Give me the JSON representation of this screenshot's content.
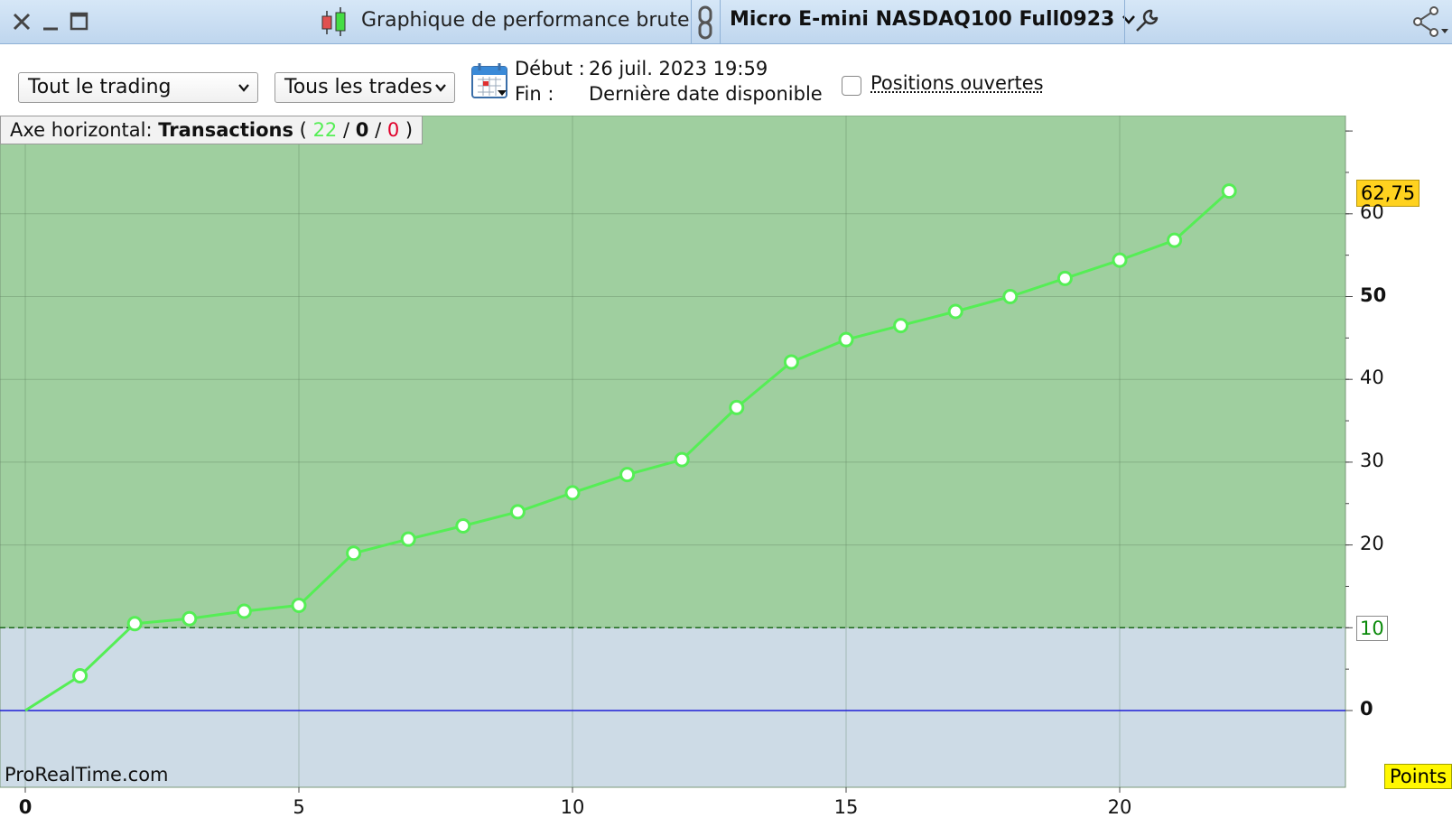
{
  "window": {
    "title": "Graphique de performance brute",
    "instrument": "Micro E-mini NASDAQ100 Full0923",
    "icons": [
      "close-icon",
      "minimize-icon",
      "maximize-icon",
      "candlestick-icon",
      "link-icon",
      "chevron-down-icon",
      "wrench-icon",
      "share-icon"
    ]
  },
  "toolbar": {
    "scope_select": "Tout le trading",
    "trades_select": "Tous les trades",
    "start_label": "Début :",
    "start_value": "26 juil. 2023 19:59",
    "end_label": "Fin :",
    "end_value": "Dernière date disponible",
    "open_positions_label": "Positions ouvertes",
    "open_positions_checked": false
  },
  "axis_badge": {
    "prefix": "Axe horizontal:",
    "mode": "Transactions",
    "open_paren": "(",
    "wins": "22",
    "sep1": "/",
    "neutral": "0",
    "sep2": "/",
    "losses": "0",
    "close_paren": ")"
  },
  "watermark": "ProRealTime.com",
  "unit_badge": "Points",
  "last_value_label": "62,75",
  "threshold_label": "10",
  "colors": {
    "positive_zone": "#9fcf9f",
    "negative_zone": "#cddbe6",
    "curve": "#55ee55",
    "zero_line": "#1f1fd6",
    "threshold_line": "#1f6a1f",
    "last_value_badge": "#ffd21f",
    "wins": "#55ee55",
    "losses": "#e0002a"
  },
  "chart_data": {
    "type": "line",
    "x": [
      0,
      1,
      2,
      3,
      4,
      5,
      6,
      7,
      8,
      9,
      10,
      11,
      12,
      13,
      14,
      15,
      16,
      17,
      18,
      19,
      20,
      21,
      22
    ],
    "series": [
      {
        "values": [
          0,
          4.2,
          10.5,
          11.1,
          12.0,
          12.7,
          19.0,
          20.7,
          22.3,
          24.0,
          26.3,
          28.5,
          30.3,
          36.6,
          42.1,
          44.8,
          46.5,
          48.2,
          50.0,
          52.2,
          54.4,
          56.8,
          62.75
        ]
      }
    ],
    "xlim": [
      0,
      24
    ],
    "ylim": [
      -9.3,
      70.5
    ],
    "xticks": [
      0,
      5,
      10,
      15,
      20
    ],
    "xtick_labels": [
      "0",
      "5",
      "10",
      "15",
      "20"
    ],
    "yticks": [
      0,
      10,
      20,
      30,
      40,
      50,
      60
    ],
    "ytick_labels": [
      "0",
      "",
      "20",
      "30",
      "40",
      "50",
      "60"
    ],
    "threshold": 10,
    "grid": true
  }
}
